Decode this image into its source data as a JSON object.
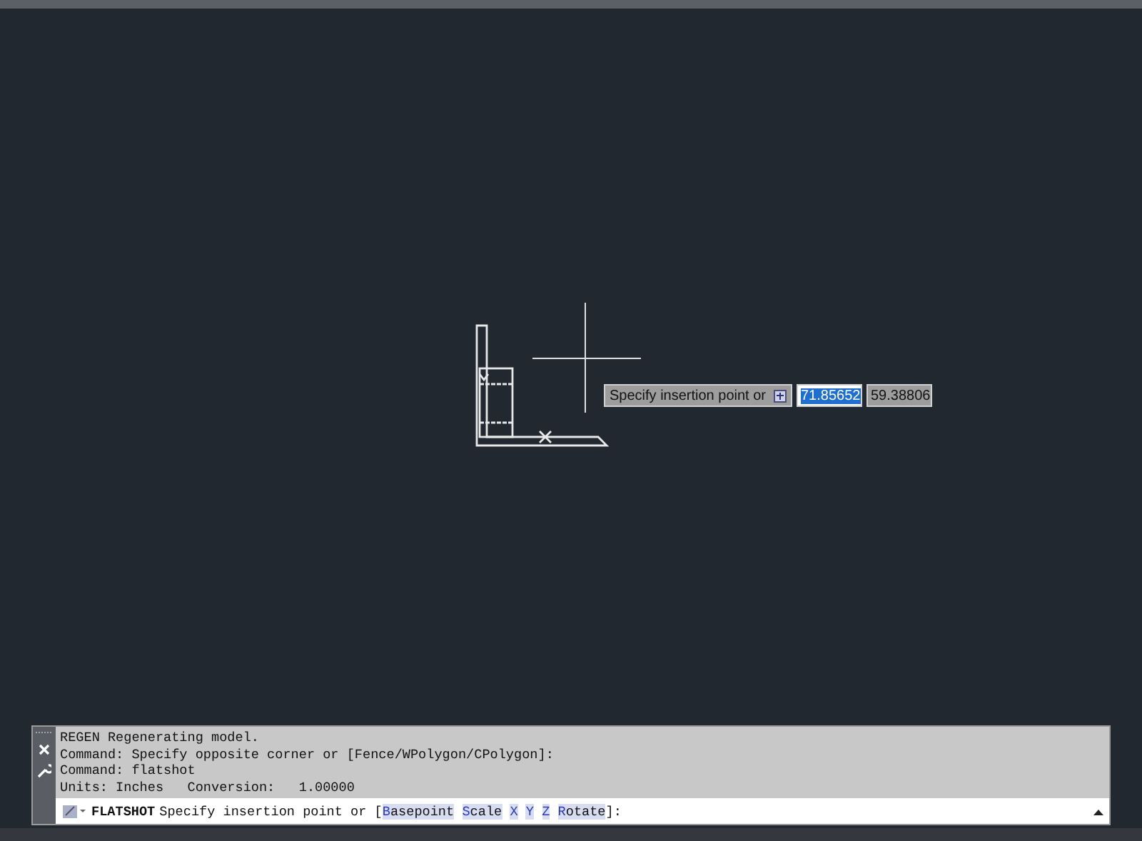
{
  "dynamic_input": {
    "prompt": "Specify insertion point or",
    "x_field": {
      "value": "71.85652",
      "selected": true
    },
    "y_field": {
      "value": "59.38806",
      "selected": false
    }
  },
  "command_line": {
    "history": [
      "REGEN Regenerating model.",
      "Command: Specify opposite corner or [Fence/WPolygon/CPolygon]:",
      "Command: flatshot",
      "Units: Inches   Conversion:   1.00000"
    ],
    "command": "FLATSHOT",
    "prompt": "Specify insertion point or [",
    "options": [
      "Basepoint",
      "Scale",
      "X",
      "Y",
      "Z",
      "Rotate"
    ],
    "suffix": "]:"
  }
}
